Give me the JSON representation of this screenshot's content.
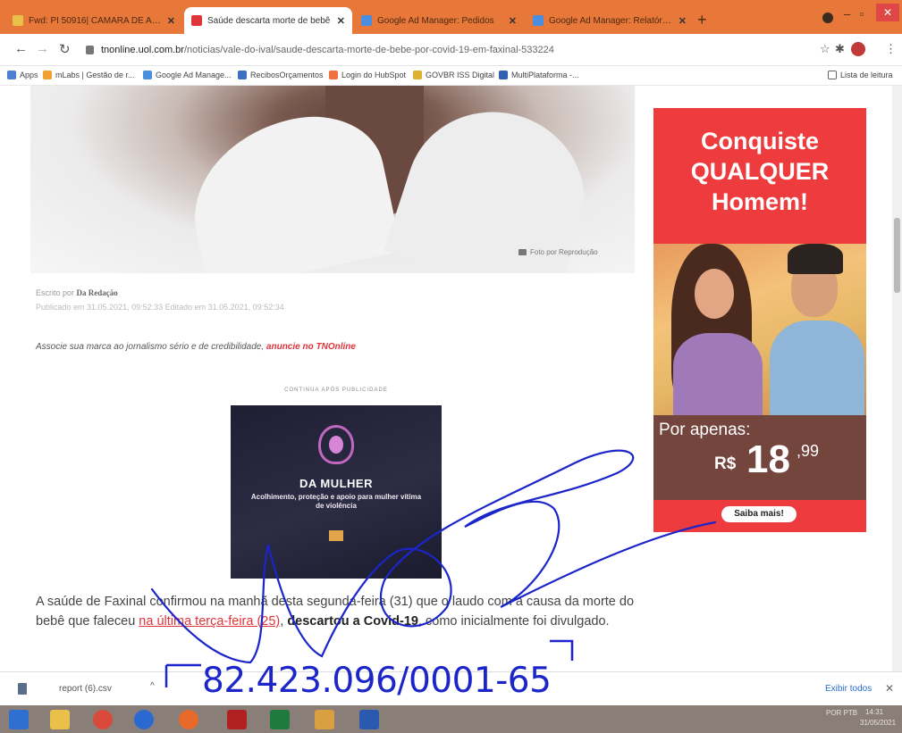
{
  "tabs": [
    {
      "title": "Fwd: PI 50916| CAMARA DE AP...",
      "active": false,
      "favicon_color": "#e8c04a"
    },
    {
      "title": "Saúde descarta morte de bebê",
      "active": true,
      "favicon_color": "#e0343b"
    },
    {
      "title": "Google Ad Manager: Pedidos",
      "active": false,
      "favicon_color": "#4a8ee0"
    },
    {
      "title": "Google Ad Manager: Relatórios",
      "active": false,
      "favicon_color": "#4a8ee0"
    }
  ],
  "new_tab_symbol": "+",
  "address": {
    "host": "tnonline.uol.com.br",
    "path": "/noticias/vale-do-ival/saude-descarta-morte-de-bebe-por-covid-19-em-faxinal-533224"
  },
  "bookmarks": [
    {
      "label": "Apps",
      "color": "#4a80d0"
    },
    {
      "label": "mLabs | Gestão de r...",
      "color": "#f0a030"
    },
    {
      "label": "Google Ad Manage...",
      "color": "#4a8ee0"
    },
    {
      "label": "RecibosOrçamentos",
      "color": "#3c70c0"
    },
    {
      "label": "Login do HubSpot",
      "color": "#f07040"
    },
    {
      "label": "GOVBR ISS Digital",
      "color": "#e0b030"
    },
    {
      "label": "MultiPlataforma -...",
      "color": "#3060b0"
    }
  ],
  "reading_list": "Lista de leitura",
  "photo_credit": "Foto por Reprodução",
  "article": {
    "author_prefix": "Escrito por",
    "author": "Da Redação",
    "dates": "Publicado em 31.05.2021, 09:52:33    Editado em 31.05.2021, 09:52:34",
    "promo_text": "Associe sua marca ao jornalismo sério e de credibilidade,",
    "promo_link": "anuncie no TNOnline",
    "ad_label": "CONTINUA APÓS PUBLICIDADE",
    "body_1": "A saúde de Faxinal confirmou na manhã desta segunda-feira (31) que o laudo com a causa da morte do bebê que faleceu",
    "body_link": "na última terça-feira (25)",
    "body_2": ",",
    "body_bold": "descartou a Covid-19",
    "body_3": ", como inicialmente foi divulgado."
  },
  "inline_ad": {
    "title": "DA MULHER",
    "description": "Acolhimento, proteção e apoio para mulher vítima de violência"
  },
  "side_ad": {
    "headline_1": "Conquiste",
    "headline_2": "QUALQUER",
    "headline_3": "Homem!",
    "price_label": "Por apenas:",
    "currency": "R$",
    "price_int": "18",
    "price_dec": ",99",
    "cta": "Saiba mais!"
  },
  "download": {
    "filename": "report (6).csv",
    "show_all": "Exibir todos"
  },
  "tray": {
    "lang": "POR PTB",
    "time": "14:31",
    "date": "31/05/2021"
  },
  "handwritten_stamp": "82.423.096/0001-65",
  "colors": {
    "tab_strip": "#e8773a",
    "accent_red": "#e0343b",
    "ink_blue": "#1b25c9"
  }
}
